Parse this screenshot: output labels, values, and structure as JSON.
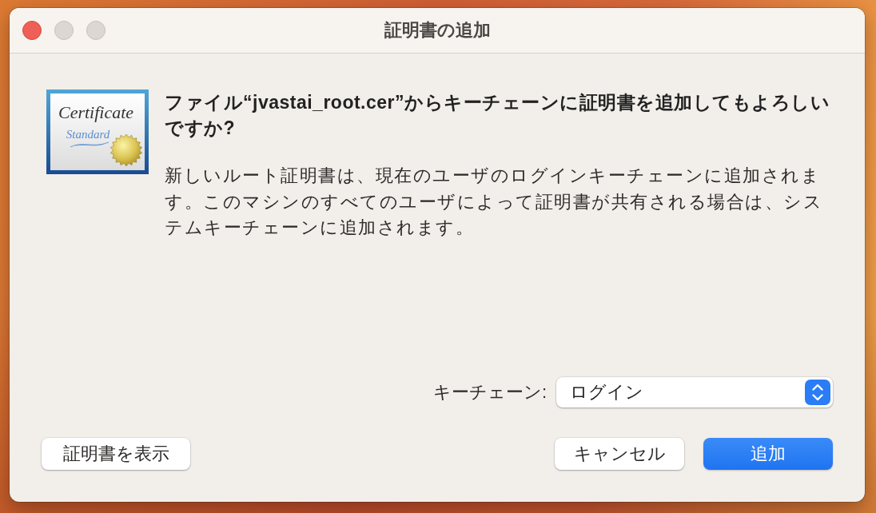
{
  "window": {
    "title": "証明書の追加",
    "controls": [
      {
        "kind": "close",
        "enabled": true
      },
      {
        "kind": "minimize",
        "enabled": false
      },
      {
        "kind": "zoom",
        "enabled": false
      }
    ]
  },
  "certificate_icon": {
    "title": "Certificate",
    "subtitle": "Standard"
  },
  "heading": "ファイル“jvastai_root.cer”からキーチェーンに証明書を追加してもよろしいですか?",
  "message": "新しいルート証明書は、現在のユーザのログインキーチェーンに追加されます。このマシンのすべてのユーザによって証明書が共有される場合は、システムキーチェーンに追加されます。",
  "keychain": {
    "label": "キーチェーン:",
    "value": "ログイン"
  },
  "secondary_buttons": [
    {
      "label": "証明書を表示",
      "default": false
    }
  ],
  "buttons": [
    {
      "label": "キャンセル",
      "default": false
    },
    {
      "label": "追加",
      "default": true
    }
  ]
}
